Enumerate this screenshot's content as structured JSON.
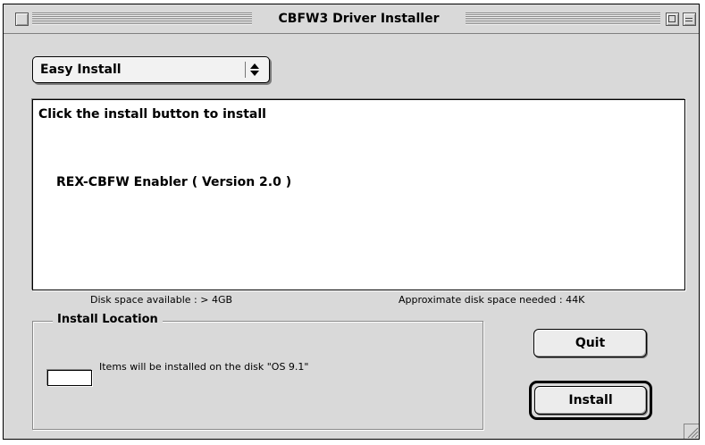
{
  "window": {
    "title": "CBFW3 Driver Installer"
  },
  "install_type": {
    "selected": "Easy Install"
  },
  "panel": {
    "heading": "Click the install button to install",
    "items": [
      "REX-CBFW Enabler ( Version 2.0 )"
    ]
  },
  "disk": {
    "available": "Disk space available : > 4GB",
    "needed": "Approximate disk space needed : 44K"
  },
  "install_location": {
    "title": "Install Location",
    "message": "Items will be installed on the disk \"OS 9.1\""
  },
  "buttons": {
    "quit": "Quit",
    "install": "Install"
  },
  "icons": {
    "close": "close-box-icon",
    "zoom": "zoom-box-icon",
    "collapse": "collapse-box-icon",
    "popup_arrows": "up-down-arrows-icon",
    "grow": "grow-box-icon"
  }
}
